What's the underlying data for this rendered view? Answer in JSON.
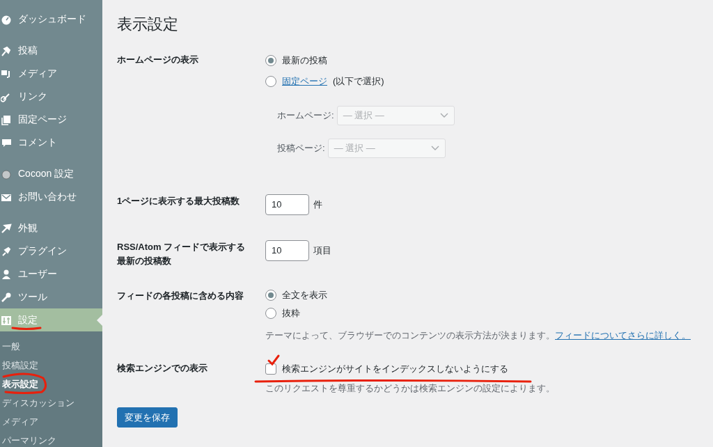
{
  "sidebar": {
    "groups": [
      [
        {
          "label": "ダッシュボード",
          "selected": false
        }
      ],
      [
        {
          "label": "投稿",
          "selected": false
        },
        {
          "label": "メディア",
          "selected": false
        },
        {
          "label": "リンク",
          "selected": false
        },
        {
          "label": "固定ページ",
          "selected": false
        },
        {
          "label": "コメント",
          "selected": false
        }
      ],
      [
        {
          "label": "Cocoon 設定",
          "selected": false
        },
        {
          "label": "お問い合わせ",
          "selected": false
        }
      ],
      [
        {
          "label": "外観",
          "selected": false
        },
        {
          "label": "プラグイン",
          "selected": false
        },
        {
          "label": "ユーザー",
          "selected": false
        },
        {
          "label": "ツール",
          "selected": false
        },
        {
          "label": "設定",
          "selected": true
        }
      ]
    ],
    "submenu": [
      {
        "label": "一般",
        "selected": false
      },
      {
        "label": "投稿設定",
        "selected": false
      },
      {
        "label": "表示設定",
        "selected": true
      },
      {
        "label": "ディスカッション",
        "selected": false
      },
      {
        "label": "メディア",
        "selected": false
      },
      {
        "label": "パーマリンク",
        "selected": false
      }
    ]
  },
  "page_title": "表示設定",
  "settings": [
    {
      "kind": "radio_group",
      "label": "ホームページの表示",
      "options": [
        {
          "label": "最新の投稿",
          "selected": true
        },
        {
          "link": "固定ページ",
          "label": "(以下で選択)",
          "selected": false
        }
      ],
      "selects": [
        {
          "label": "ホームページ:",
          "value": "— 選択 —",
          "disabled": true
        },
        {
          "label": "投稿ページ:",
          "value": "— 選択 —",
          "disabled": true
        }
      ]
    },
    {
      "kind": "number",
      "label": "1ページに表示する最大投稿数",
      "value": "10",
      "unit": "件"
    },
    {
      "kind": "number",
      "label": "RSS/Atom フィードで表示する最新の投稿数",
      "value": "10",
      "unit": "項目"
    },
    {
      "kind": "radio_group",
      "label": "フィードの各投稿に含める内容",
      "options": [
        {
          "label": "全文を表示",
          "selected": true
        },
        {
          "label": "抜粋",
          "selected": false
        }
      ],
      "description": "テーマによって、ブラウザーでのコンテンツの表示方法が決まります。",
      "description_link": "フィードについてさらに詳しく。"
    },
    {
      "kind": "checkbox",
      "label": "検索エンジンでの表示",
      "checkbox": {
        "label": "検索エンジンがサイトをインデックスしないようにする",
        "checked": false
      },
      "description": "このリクエストを尊重するかどうかは検索エンジンの設定によります。"
    }
  ],
  "save_button": "変更を保存"
}
